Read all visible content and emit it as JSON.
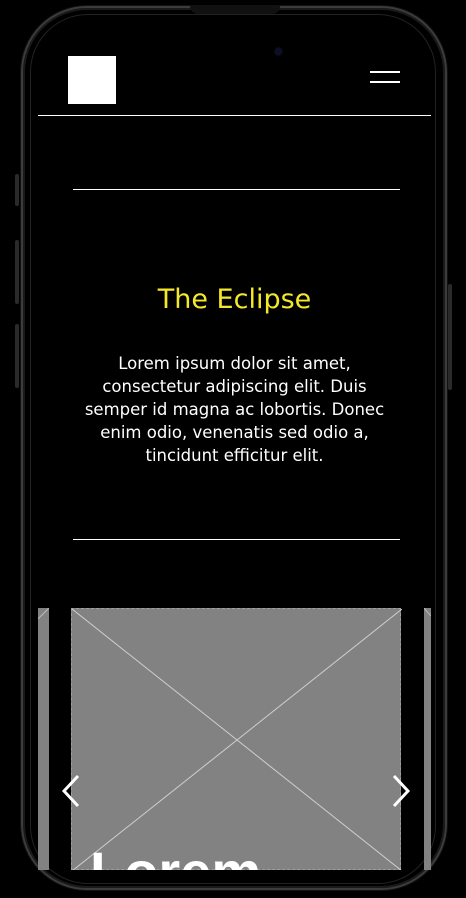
{
  "header": {
    "logo_icon": "square-logo",
    "menu_icon": "hamburger-menu-icon"
  },
  "hero": {
    "title": "The Eclipse",
    "body": "Lorem ipsum dolor sit amet, consectetur adipiscing elit. Duis semper id magna ac lobortis. Donec enim odio, venenatis sed odio a, tincidunt efficitur elit."
  },
  "carousel": {
    "slide_heading": "Lorem",
    "prev_icon": "chevron-left-icon",
    "next_icon": "chevron-right-icon",
    "image_placeholder_icon": "image-placeholder-icon"
  },
  "colors": {
    "background": "#000000",
    "accent": "#f3e82a",
    "placeholder": "#828282"
  }
}
